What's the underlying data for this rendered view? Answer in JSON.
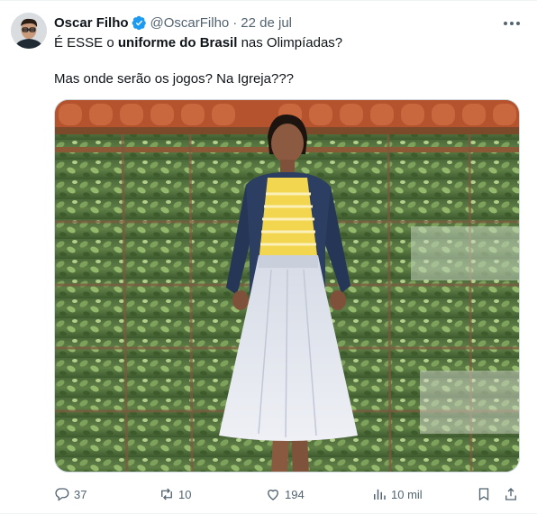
{
  "author": {
    "display_name": "Oscar Filho",
    "handle": "@OscarFilho",
    "separator": "·",
    "date": "22 de jul",
    "verified": true
  },
  "tweet": {
    "line1_part1": "É ESSE o ",
    "line1_bold": "uniforme do Brasil",
    "line1_part2": " nas Olimpíadas?",
    "line2": "Mas onde serão os jogos? Na Igreja???"
  },
  "media": {
    "icon": "photo-of-woman-in-denim-jacket-and-white-skirt"
  },
  "actions": {
    "replies": "37",
    "retweets": "10",
    "likes": "194",
    "views": "10 mil"
  },
  "colors": {
    "verified": "#1d9bf0",
    "text": "#0f1419",
    "muted": "#536471"
  }
}
